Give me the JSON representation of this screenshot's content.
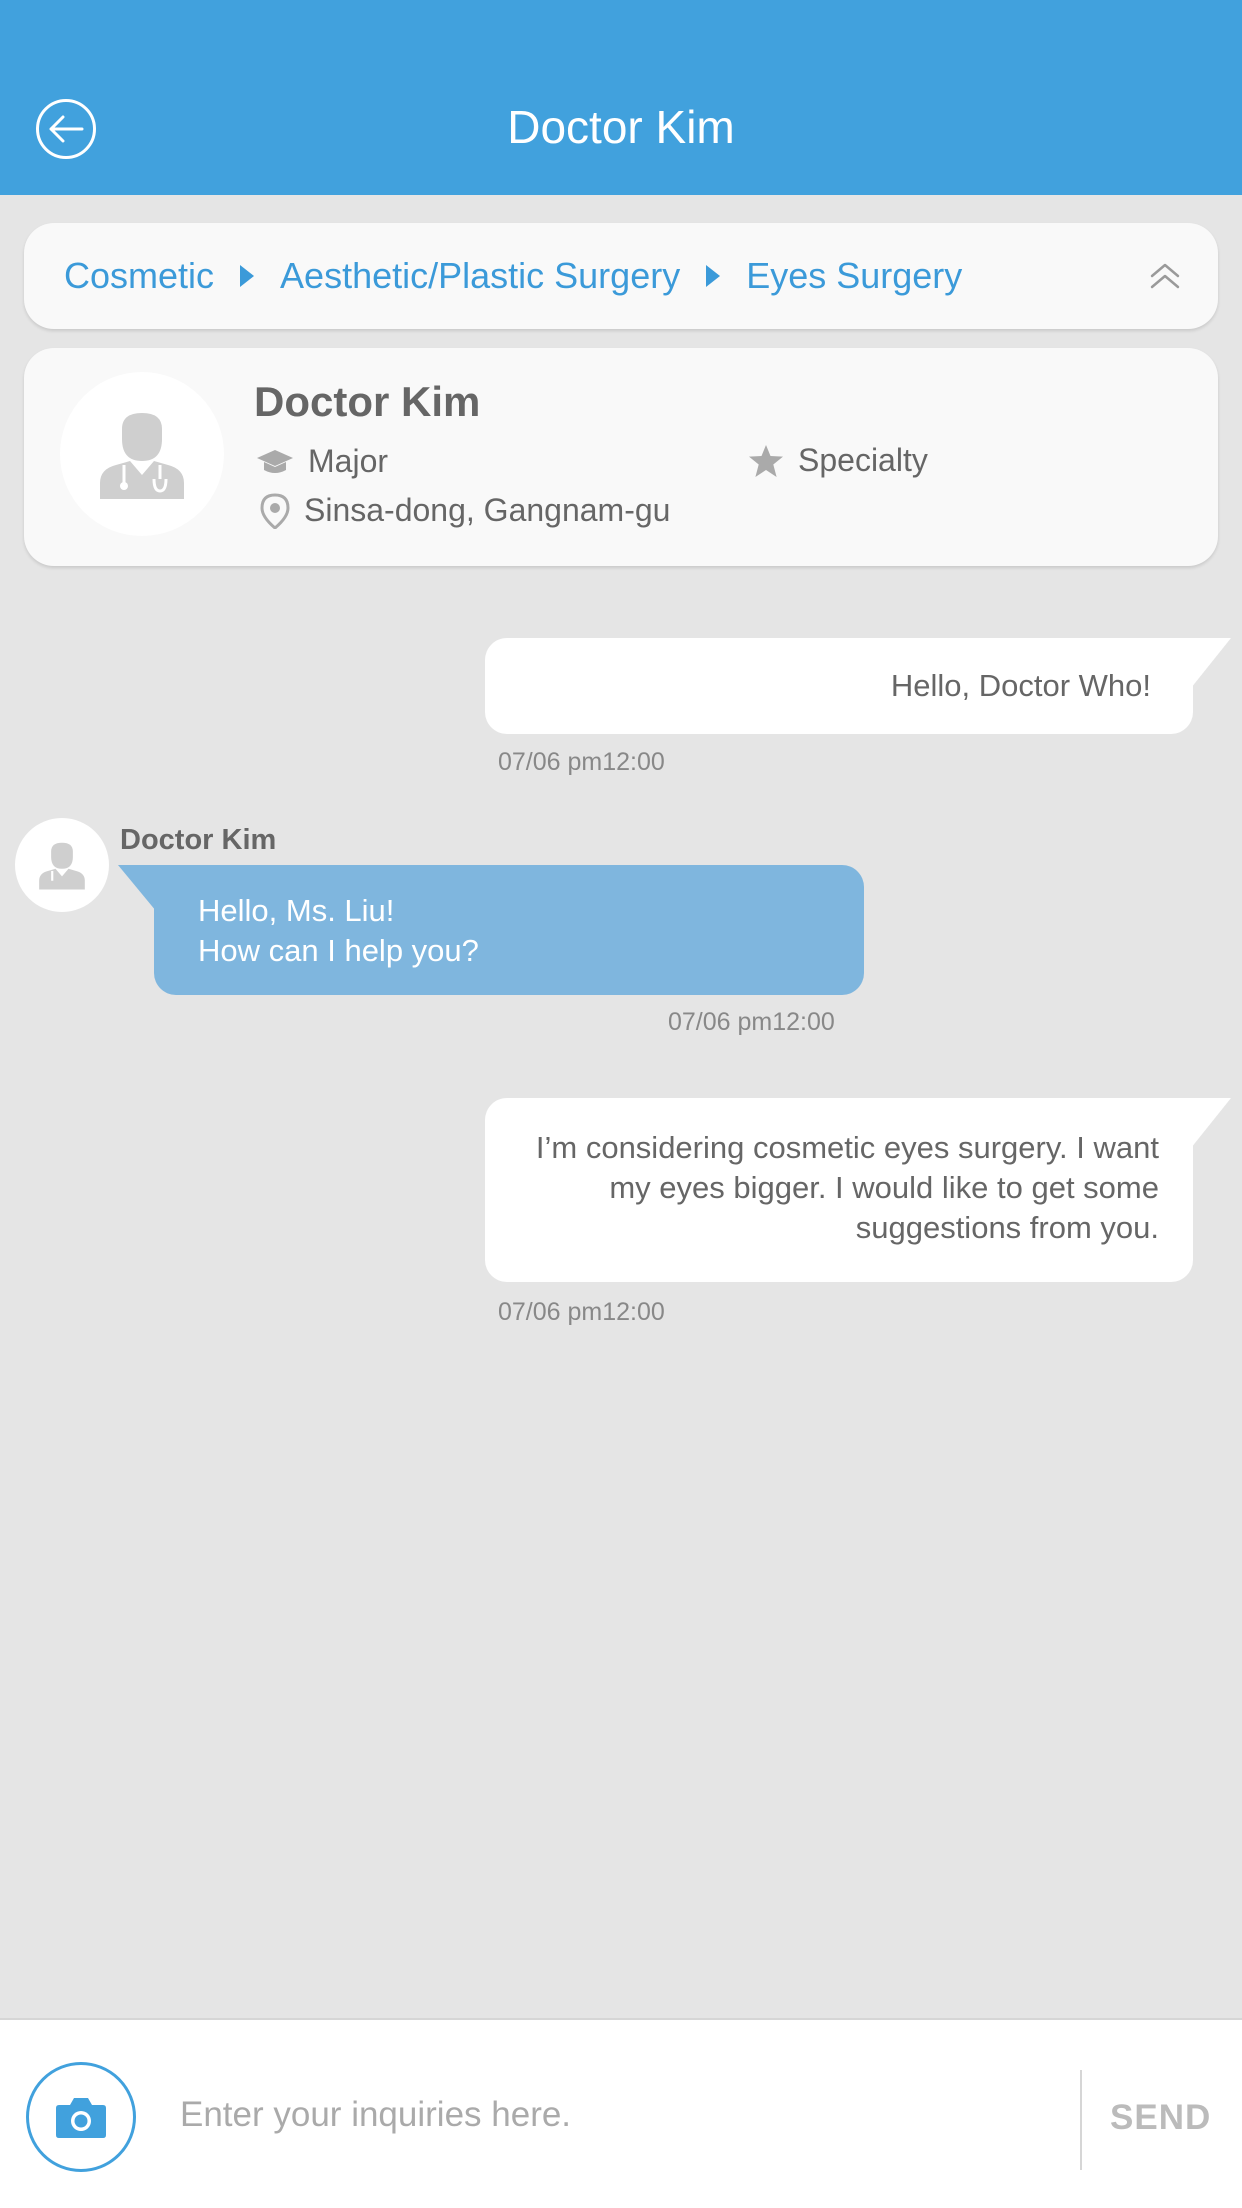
{
  "header": {
    "title": "Doctor Kim"
  },
  "breadcrumb": {
    "items": [
      "Cosmetic",
      "Aesthetic/Plastic Surgery",
      "Eyes Surgery"
    ]
  },
  "doctor": {
    "name": "Doctor Kim",
    "major_label": "Major",
    "specialty_label": "Specialty",
    "location": "Sinsa-dong, Gangnam-gu"
  },
  "messages": [
    {
      "side": "right",
      "lines": [
        "Hello, Doctor Who!"
      ],
      "time": "07/06  pm12:00"
    },
    {
      "side": "left",
      "sender": "Doctor Kim",
      "lines": [
        "Hello, Ms. Liu!",
        "How can I help you?"
      ],
      "time": "07/06  pm12:00"
    },
    {
      "side": "right",
      "lines": [
        "I’m considering cosmetic eyes surgery. I want",
        "my eyes bigger. I would like to get some",
        "suggestions from you."
      ],
      "time": "07/06  pm12:00"
    }
  ],
  "composer": {
    "placeholder": "Enter your inquiries here.",
    "send_label": "SEND"
  },
  "colors": {
    "brand": "#41a1dd",
    "bubble_in": "#7fb6de",
    "background": "#e5e5e5"
  }
}
